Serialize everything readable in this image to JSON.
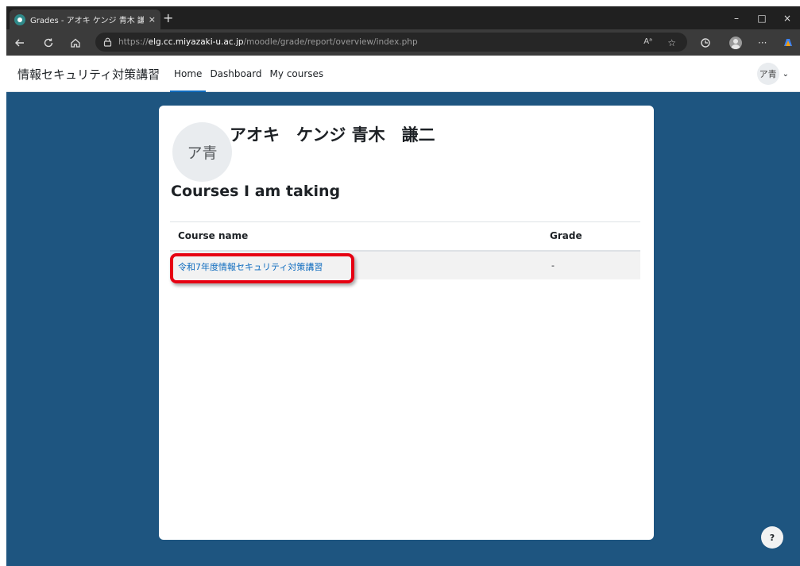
{
  "browser": {
    "tab_title": "Grades - アオキ ケンジ 青木 謙二",
    "tab_close": "×",
    "new_tab": "+",
    "url": {
      "scheme": "https://",
      "host": "elg.cc.miyazaki-u.ac.jp",
      "path": "/moodle/grade/report/overview/index.php"
    },
    "window_controls": {
      "minimize": "–",
      "maximize": "□",
      "close": "×"
    },
    "icons": {
      "back": "back-icon",
      "refresh": "refresh-icon",
      "home": "home-icon",
      "site_info": "lock-icon",
      "read_aloud": "read-aloud-icon",
      "favorite": "star-icon",
      "extensions": "extension-icon",
      "profile": "profile-icon",
      "more": "more-icon",
      "copilot": "copilot-icon"
    },
    "read_aloud_label": "Aᵃ",
    "more_label": "···"
  },
  "site": {
    "brand": "情報セキュリティ対策講習",
    "nav": [
      {
        "label": "Home",
        "active": true
      },
      {
        "label": "Dashboard",
        "active": false
      },
      {
        "label": "My courses",
        "active": false
      }
    ],
    "user_initials": "ア青",
    "user_caret": "⌄"
  },
  "main": {
    "avatar_initials": "ア青",
    "fullname": "アオキ　ケンジ 青木　謙二",
    "section_title": "Courses I am taking",
    "table": {
      "headers": {
        "course": "Course name",
        "grade": "Grade"
      },
      "rows": [
        {
          "course": "令和7年度情報セキュリティ対策講習",
          "grade": "-"
        }
      ]
    }
  },
  "help_label": "?",
  "colors": {
    "brand_blue": "#0f6cbf",
    "page_background": "#1e5580",
    "highlight": "#e60012"
  }
}
